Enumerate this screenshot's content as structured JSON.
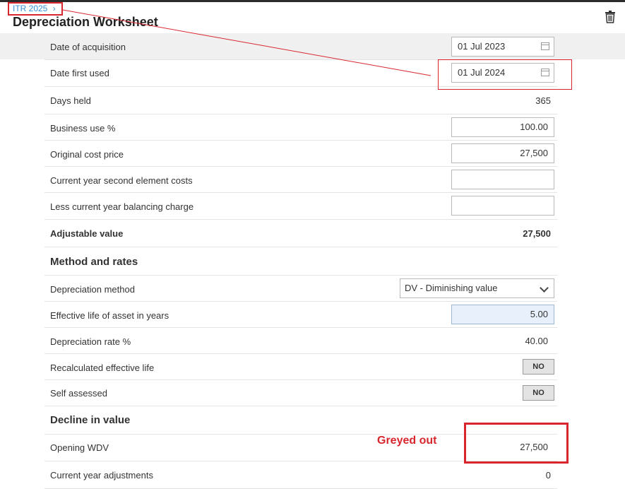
{
  "header": {
    "breadcrumb": "ITR 2025",
    "breadcrumb_chevron": "›",
    "title": "Depreciation Worksheet",
    "trash_icon": "trash-icon"
  },
  "rows": {
    "date_acquisition": {
      "label": "Date of acquisition",
      "value": "01 Jul 2023"
    },
    "date_first_used": {
      "label": "Date first used",
      "value": "01 Jul 2024"
    },
    "days_held": {
      "label": "Days held",
      "value": "365"
    },
    "business_use": {
      "label": "Business use %",
      "value": "100.00"
    },
    "original_cost": {
      "label": "Original cost price",
      "value": "27,500"
    },
    "second_element": {
      "label": "Current year second element costs",
      "value": ""
    },
    "balancing_charge": {
      "label": "Less current year balancing charge",
      "value": ""
    },
    "adjustable_value": {
      "label": "Adjustable value",
      "value": "27,500"
    }
  },
  "method": {
    "heading": "Method and rates",
    "depreciation_method": {
      "label": "Depreciation method",
      "value": "DV - Diminishing value"
    },
    "effective_life": {
      "label": "Effective life of asset in years",
      "value": "5.00"
    },
    "rate": {
      "label": "Depreciation rate %",
      "value": "40.00"
    },
    "recalculated": {
      "label": "Recalculated effective life",
      "value": "NO"
    },
    "self_assessed": {
      "label": "Self assessed",
      "value": "NO"
    }
  },
  "decline": {
    "heading": "Decline in value",
    "opening_wdv": {
      "label": "Opening WDV",
      "value": "27,500"
    },
    "adjustments": {
      "label": "Current year adjustments",
      "value": "0"
    }
  },
  "annotation": {
    "text": "Greyed out"
  },
  "colors": {
    "annotation": "#d9262e",
    "link": "#3a8fd6",
    "highlight_field": "#e8f0fb"
  }
}
